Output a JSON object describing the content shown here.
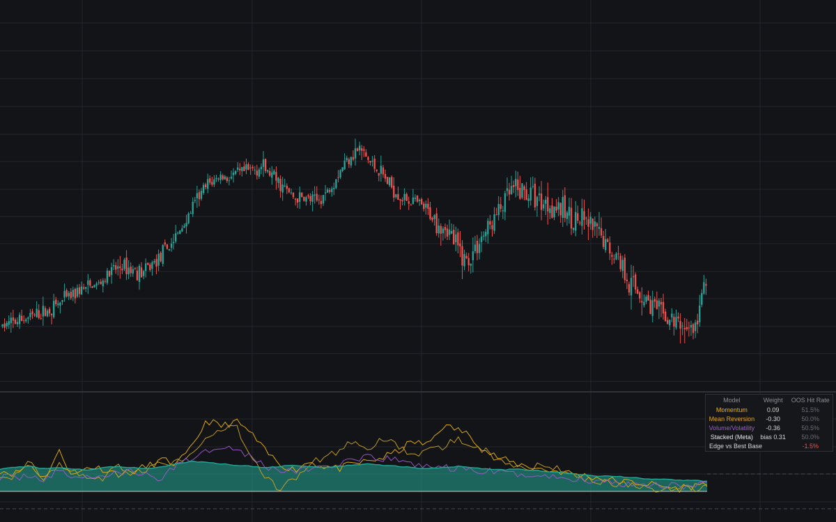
{
  "colors": {
    "background": "#131418",
    "up": "#26a69a",
    "down": "#ef5350",
    "momentum": "#e9b10a",
    "mean_reversion": "#c9a227",
    "volume_volatility": "#9c5bcb",
    "stacked": "#ffffff",
    "stacked_fill": "#23a896",
    "edge_negative": "#ef5350"
  },
  "legend": {
    "headers": {
      "model": "Model",
      "weight": "Weight",
      "hit": "OOS Hit Rate"
    },
    "rows": [
      {
        "model": "Momentum",
        "weight": "0.09",
        "hit": "51.5%"
      },
      {
        "model": "Mean Reversion",
        "weight": "-0.30",
        "hit": "50.0%"
      },
      {
        "model": "Volume/Volatility",
        "weight": "-0.36",
        "hit": "50.5%"
      },
      {
        "model": "Stacked (Meta)",
        "weight": "bias 0.31",
        "hit": "50.0%"
      }
    ],
    "edge": {
      "label": "Edge vs Best Base",
      "value": "-1.5%"
    }
  },
  "chart_data": [
    {
      "type": "candlestick",
      "title": "",
      "price_range_approx": [
        2,
        100
      ],
      "series": [
        {
          "name": "",
          "trend_close": [
            14,
            15,
            16,
            17,
            18,
            20,
            22,
            24,
            25,
            26,
            29,
            31,
            30,
            29,
            32,
            35,
            39,
            44,
            50,
            54,
            56,
            56,
            57,
            58,
            59,
            56,
            53,
            50,
            50,
            49,
            52,
            57,
            62,
            64,
            60,
            57,
            53,
            50,
            49,
            47,
            44,
            42,
            36,
            32,
            38,
            42,
            47,
            52,
            52,
            51,
            49,
            48,
            46,
            44,
            43,
            40,
            36,
            33,
            26,
            23,
            20,
            17,
            15,
            14,
            13,
            28
          ]
        }
      ]
    },
    {
      "type": "line",
      "title": "",
      "subtitle": "model predictions / hit rate panel",
      "series": [
        {
          "name": "Momentum",
          "values": [
            55,
            52,
            60,
            48,
            70,
            50,
            58,
            56,
            52,
            54,
            58,
            63,
            60,
            72,
            95,
            90,
            94,
            85,
            70,
            60,
            55,
            62,
            58,
            56,
            60,
            62,
            65,
            70,
            78,
            75,
            90,
            88,
            82,
            70,
            64,
            60,
            58,
            55,
            54,
            52,
            50,
            48,
            46,
            45,
            44,
            42,
            40,
            42,
            45
          ]
        },
        {
          "name": "Mean Reversion",
          "values": [
            52,
            50,
            65,
            46,
            60,
            55,
            50,
            48,
            58,
            52,
            56,
            60,
            62,
            68,
            80,
            85,
            92,
            65,
            50,
            40,
            48,
            60,
            66,
            70,
            78,
            72,
            80,
            74,
            66,
            70,
            72,
            80,
            76,
            70,
            62,
            58,
            56,
            60,
            55,
            50,
            48,
            46,
            44,
            42,
            40,
            38,
            42,
            40,
            41
          ]
        },
        {
          "name": "Volume/Volatility",
          "values": [
            50,
            48,
            52,
            47,
            54,
            50,
            49,
            51,
            52,
            55,
            50,
            48,
            60,
            65,
            70,
            75,
            72,
            66,
            58,
            55,
            54,
            56,
            58,
            60,
            62,
            65,
            64,
            63,
            60,
            58,
            57,
            56,
            55,
            54,
            53,
            52,
            51,
            50,
            49,
            48,
            47,
            46,
            45,
            44,
            44,
            43,
            43,
            42,
            43
          ]
        },
        {
          "name": "Stacked (Meta)",
          "values": [
            56,
            57,
            58,
            56,
            57,
            56,
            55,
            57,
            58,
            57,
            56,
            58,
            60,
            62,
            61,
            60,
            59,
            58,
            57,
            58,
            59,
            58,
            57,
            58,
            59,
            60,
            59,
            58,
            57,
            56,
            57,
            58,
            57,
            56,
            55,
            56,
            55,
            54,
            53,
            52,
            51,
            50,
            50,
            49,
            48,
            48,
            47,
            47,
            46
          ]
        }
      ]
    }
  ]
}
